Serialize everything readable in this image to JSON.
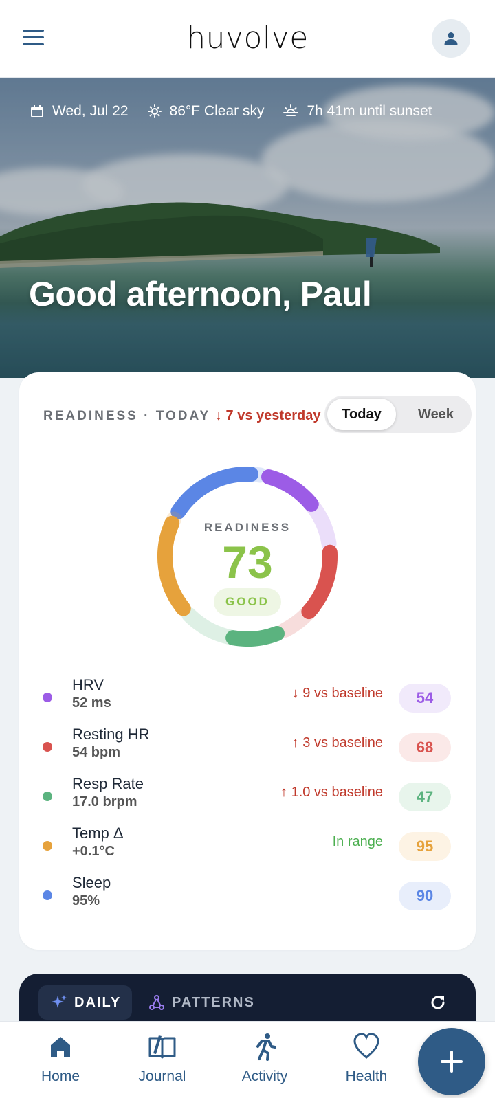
{
  "app": {
    "logo": "huvolve"
  },
  "header": {
    "menu_icon": "hamburger-menu-icon",
    "profile_icon": "user-icon"
  },
  "hero": {
    "date": "Wed, Jul 22",
    "weather": "86°F Clear sky",
    "sunset": "7h 41m until sunset",
    "greeting": "Good afternoon, Paul"
  },
  "readiness": {
    "title": "READINESS · TODAY",
    "delta": "↓ 7 vs yesterday",
    "toggle": {
      "today": "Today",
      "week": "Week",
      "selected": "Today"
    },
    "ring": {
      "label": "READINESS",
      "score": "73",
      "status": "GOOD"
    },
    "colors": {
      "good": "#8bc34a",
      "negative": "#c0392b",
      "positive": "#4caf50"
    },
    "metrics": [
      {
        "name": "HRV",
        "value": "52 ms",
        "change": "↓ 9 vs baseline",
        "change_type": "negative",
        "score": "54",
        "score_num": 54,
        "color": "#9c5ce6",
        "bg": "#f1eafb"
      },
      {
        "name": "Resting HR",
        "value": "54 bpm",
        "change": "↑ 3 vs baseline",
        "change_type": "negative",
        "score": "68",
        "score_num": 68,
        "color": "#d9534f",
        "bg": "#fbe9e8"
      },
      {
        "name": "Resp Rate",
        "value": "17.0 brpm",
        "change": "↑ 1.0 vs baseline",
        "change_type": "negative",
        "score": "47",
        "score_num": 47,
        "color": "#5bb37f",
        "bg": "#e8f5ec"
      },
      {
        "name": "Temp Δ",
        "value": "+0.1°C",
        "change": "In range",
        "change_type": "positive",
        "score": "95",
        "score_num": 95,
        "color": "#e6a23c",
        "bg": "#fdf3e4"
      },
      {
        "name": "Sleep",
        "value": "95%",
        "change": "",
        "change_type": "none",
        "score": "90",
        "score_num": 90,
        "color": "#5b86e5",
        "bg": "#e8eefb"
      }
    ]
  },
  "insights": {
    "tabs": [
      {
        "label": "DAILY",
        "icon": "sparkle-icon",
        "active": true
      },
      {
        "label": "PATTERNS",
        "icon": "network-icon",
        "active": false
      }
    ],
    "refresh_icon": "refresh-icon"
  },
  "nav": {
    "items": [
      {
        "label": "Home",
        "icon": "home-icon"
      },
      {
        "label": "Journal",
        "icon": "book-icon"
      },
      {
        "label": "Activity",
        "icon": "running-icon"
      },
      {
        "label": "Health",
        "icon": "heart-icon"
      }
    ],
    "fab_icon": "plus-icon"
  }
}
